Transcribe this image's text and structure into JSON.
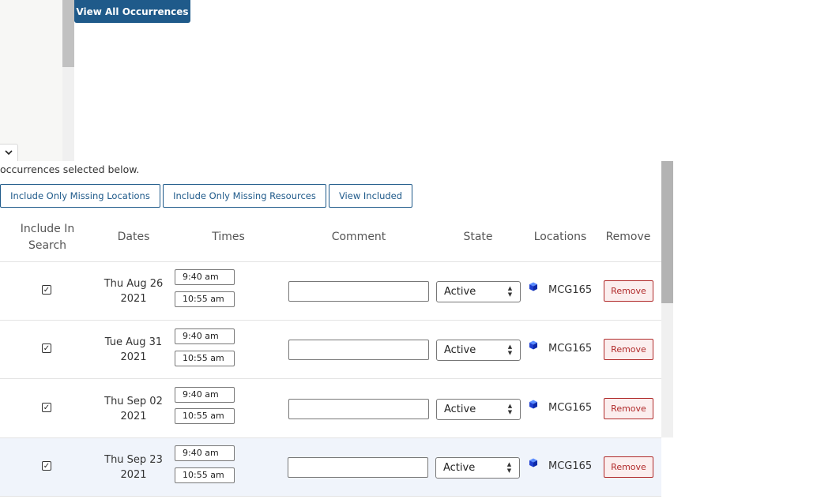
{
  "top": {
    "view_all_label": "View All Occurrences"
  },
  "instruction": "occurrences selected below.",
  "filters": {
    "missing_locations": "Include Only Missing Locations",
    "missing_resources": "Include Only Missing Resources",
    "view_included": "View Included"
  },
  "columns": {
    "include_line1": "Include In",
    "include_line2": "Search",
    "dates": "Dates",
    "times": "Times",
    "comment": "Comment",
    "state": "State",
    "locations": "Locations",
    "remove": "Remove"
  },
  "rows": [
    {
      "date_line1": "Thu Aug 26",
      "date_line2": "2021",
      "start": "9:40 am",
      "end": "10:55 am",
      "state": "Active",
      "location": "MCG165",
      "remove": "Remove",
      "included": true
    },
    {
      "date_line1": "Tue Aug 31",
      "date_line2": "2021",
      "start": "9:40 am",
      "end": "10:55 am",
      "state": "Active",
      "location": "MCG165",
      "remove": "Remove",
      "included": true
    },
    {
      "date_line1": "Thu Sep 02",
      "date_line2": "2021",
      "start": "9:40 am",
      "end": "10:55 am",
      "state": "Active",
      "location": "MCG165",
      "remove": "Remove",
      "included": true
    },
    {
      "date_line1": "Thu Sep 23",
      "date_line2": "2021",
      "start": "9:40 am",
      "end": "10:55 am",
      "state": "Active",
      "location": "MCG165",
      "remove": "Remove",
      "included": true
    }
  ],
  "icons": {
    "checkbox": "checkbox-checked-icon",
    "location": "cube-icon",
    "collapse": "chevron-down-icon"
  },
  "colors": {
    "primary": "#1f5a8a",
    "danger": "#b02a2a",
    "highlight_row": "#f0f4fb"
  }
}
